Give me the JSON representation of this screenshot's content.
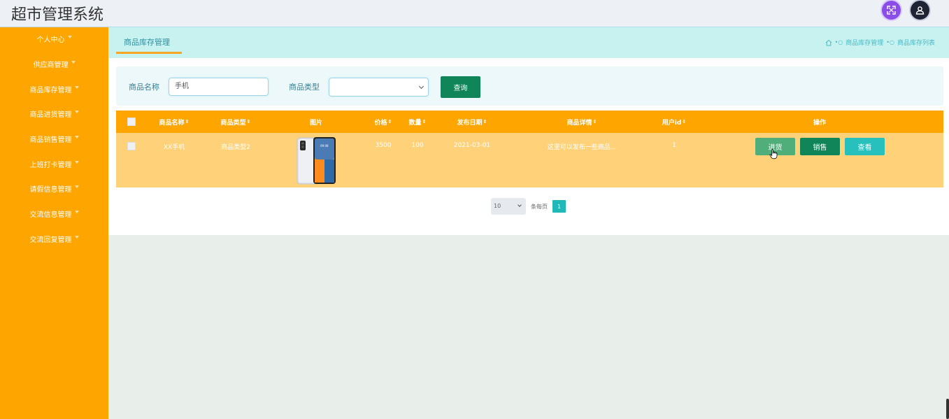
{
  "app": {
    "title": "超市管理系统"
  },
  "header": {
    "fullscreen_icon": "fullscreen-icon",
    "user_icon": "user-icon"
  },
  "sidebar": {
    "items": [
      {
        "label": "个人中心"
      },
      {
        "label": "供应商管理"
      },
      {
        "label": "商品库存管理"
      },
      {
        "label": "商品进货管理"
      },
      {
        "label": "商品销售管理"
      },
      {
        "label": "上班打卡管理"
      },
      {
        "label": "请假信息管理"
      },
      {
        "label": "交流信息管理"
      },
      {
        "label": "交流回复管理"
      }
    ]
  },
  "tabs": {
    "active": "商品库存管理"
  },
  "breadcrumb": {
    "home_icon": "home-icon",
    "items": [
      "商品库存管理",
      "商品库存列表"
    ]
  },
  "search": {
    "name_label": "商品名称",
    "name_value": "手机",
    "type_label": "商品类型",
    "type_value": "",
    "query_button": "查询"
  },
  "table": {
    "columns": [
      "商品名称",
      "商品类型",
      "图片",
      "价格",
      "数量",
      "发布日期",
      "商品详情",
      "用户id",
      "操作"
    ],
    "rows": [
      {
        "name": "XX手机",
        "type": "商品类型2",
        "image": "phone-image",
        "price": "3500",
        "quantity": "100",
        "date": "2021-03-01",
        "detail": "这里可以发布一些商品...",
        "user_id": "1",
        "actions": [
          "进货",
          "销售",
          "查看"
        ]
      }
    ]
  },
  "pagination": {
    "page_size": "10",
    "per_page_label": "条每页",
    "current_page": "1"
  },
  "colors": {
    "sidebar": "#ffa500",
    "accent": "#20b9b8",
    "primary_button": "#11855a",
    "row_bg": "#ffd27a"
  }
}
